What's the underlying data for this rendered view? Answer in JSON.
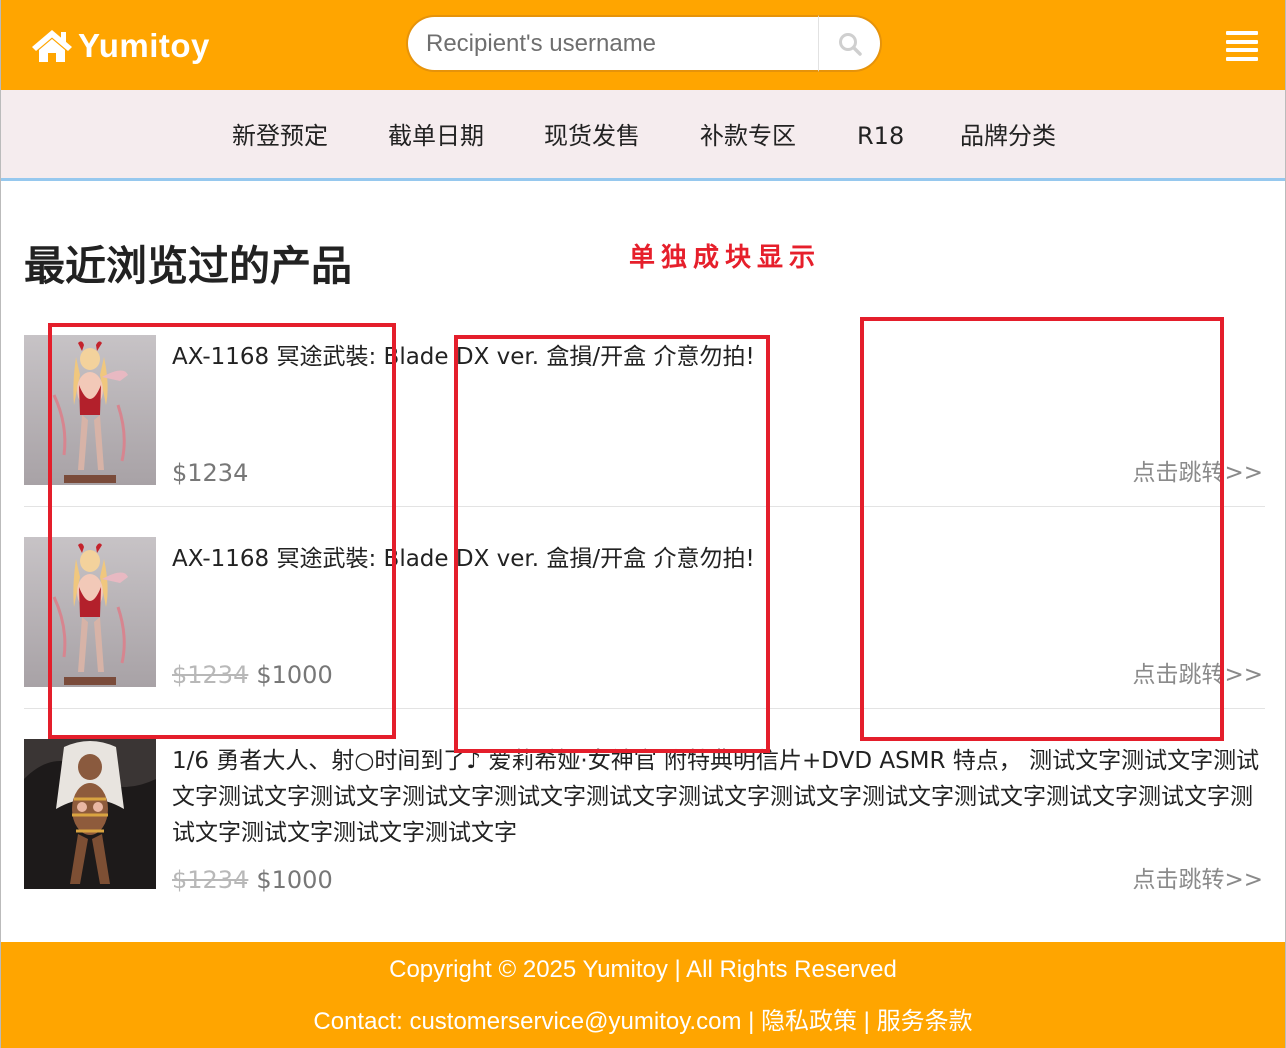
{
  "header": {
    "logo_text": "Yumitoy",
    "search_placeholder": "Recipient's username",
    "colors": {
      "header_bg": "#ffa500",
      "nav_bg": "#f5ecee",
      "nav_border": "#96c8ee",
      "annotation": "#e61f2b"
    }
  },
  "nav": {
    "items": [
      {
        "label": "新登预定"
      },
      {
        "label": "截单日期"
      },
      {
        "label": "现货发售"
      },
      {
        "label": "补款专区"
      },
      {
        "label": "R18"
      },
      {
        "label": "品牌分类"
      }
    ]
  },
  "section": {
    "title": "最近浏览过的产品",
    "annotation": "单独成块显示"
  },
  "products": [
    {
      "title": "AX-1168 冥途武裝: Blade DX ver. 盒損/开盒 介意勿拍!",
      "price": "$1234",
      "link": "点击跳转>>"
    },
    {
      "title": "AX-1168 冥途武裝: Blade DX ver. 盒損/开盒 介意勿拍!",
      "old_price": "$1234",
      "price": "$1000",
      "link": "点击跳转>>"
    },
    {
      "title": "1/6 勇者大人、射○时间到了♪ 爱莉希娅·女神官 附特典明信片+DVD ASMR 特点， 测试文字测试文字测试文字测试文字测试文字测试文字测试文字测试文字测试文字测试文字测试文字测试文字测试文字测试文字测试文字测试文字测试文字测试文字",
      "old_price": "$1234",
      "price": "$1000",
      "link": "点击跳转>>"
    }
  ],
  "footer": {
    "copyright": "Copyright © 2025 Yumitoy | All Rights Reserved",
    "contact_prefix": "Contact: ",
    "email": "customerservice@yumitoy.com",
    "sep1": " | ",
    "privacy": "隐私政策",
    "sep2": " | ",
    "terms": "服务条款"
  }
}
